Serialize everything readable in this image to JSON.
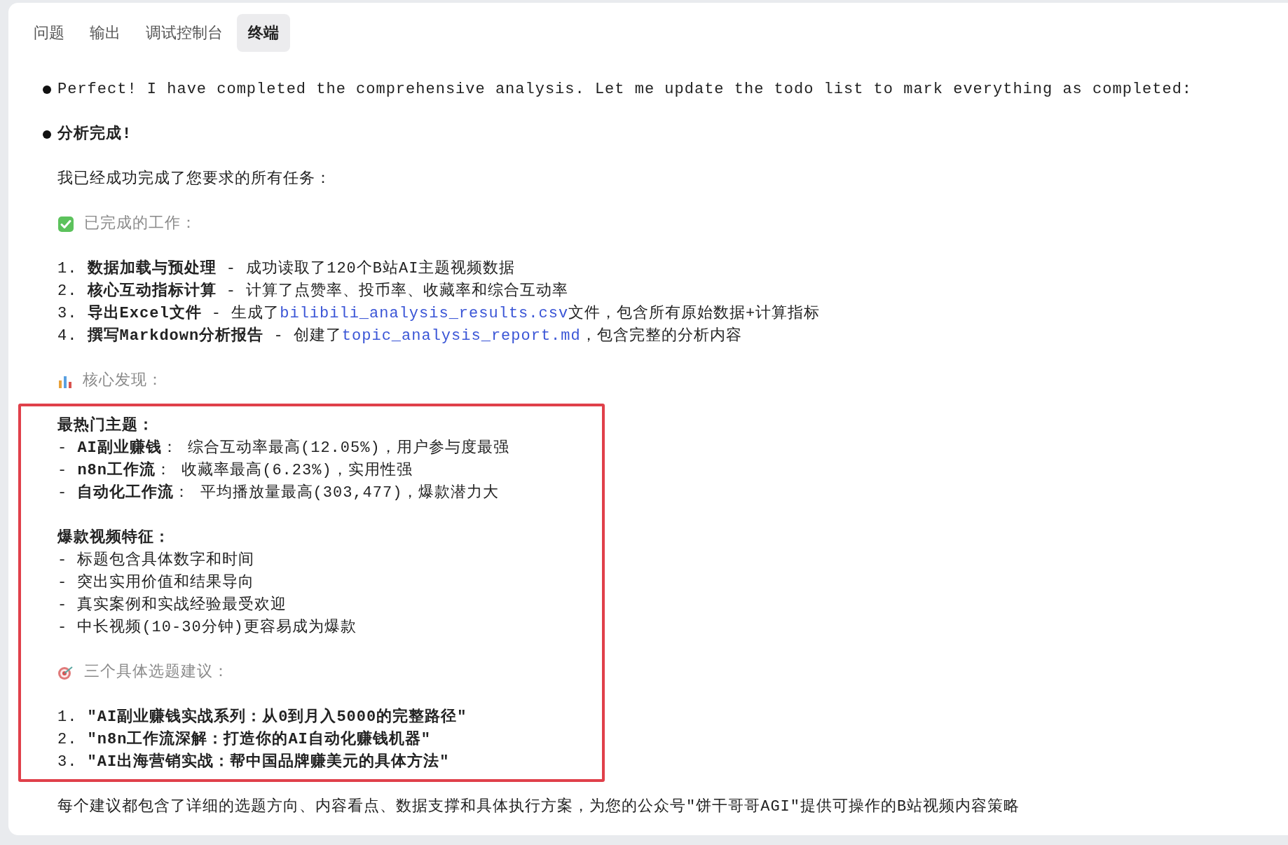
{
  "tabs": [
    {
      "label": "问题",
      "selected": false
    },
    {
      "label": "输出",
      "selected": false
    },
    {
      "label": "调试控制台",
      "selected": false
    },
    {
      "label": "终端",
      "selected": true
    }
  ],
  "blocks": [
    {
      "kind": "bullet",
      "bold": false,
      "text": "Perfect! I have completed the comprehensive analysis. Let me update the todo list to mark everything as completed:"
    },
    {
      "kind": "bullet",
      "bold": true,
      "text": "分析完成!"
    },
    {
      "kind": "text",
      "text": "我已经成功完成了您要求的所有任务："
    },
    {
      "kind": "check_heading",
      "text": "已完成的工作："
    },
    {
      "kind": "list",
      "lines": [
        [
          {
            "text": "1. ",
            "kind": "plain"
          },
          {
            "text": "数据加载与预处理",
            "kind": "bold"
          },
          {
            "text": " - 成功读取了120个B站AI主题视频数据",
            "kind": "plain"
          }
        ],
        [
          {
            "text": "2. ",
            "kind": "plain"
          },
          {
            "text": "核心互动指标计算",
            "kind": "bold"
          },
          {
            "text": " - 计算了点赞率、投币率、收藏率和综合互动率",
            "kind": "plain"
          }
        ],
        [
          {
            "text": "3. ",
            "kind": "plain"
          },
          {
            "text": "导出Excel文件",
            "kind": "bold"
          },
          {
            "text": " - 生成了",
            "kind": "plain"
          },
          {
            "text": "bilibili_analysis_results.csv",
            "kind": "link"
          },
          {
            "text": "文件，包含所有原始数据+计算指标",
            "kind": "plain"
          }
        ],
        [
          {
            "text": "4. ",
            "kind": "plain"
          },
          {
            "text": "撰写Markdown分析报告",
            "kind": "bold"
          },
          {
            "text": " - 创建了",
            "kind": "plain"
          },
          {
            "text": "topic_analysis_report.md",
            "kind": "link"
          },
          {
            "text": "，包含完整的分析内容",
            "kind": "plain"
          }
        ]
      ]
    },
    {
      "kind": "chart_heading",
      "text": "核心发现："
    },
    {
      "kind": "highlight",
      "blocks": [
        {
          "kind": "list",
          "lines": [
            [
              {
                "text": "最热门主题：",
                "kind": "bold"
              }
            ],
            [
              {
                "text": "- ",
                "kind": "plain"
              },
              {
                "text": "AI副业赚钱",
                "kind": "bold"
              },
              {
                "text": "： 综合互动率最高(12.05%)，用户参与度最强",
                "kind": "plain"
              }
            ],
            [
              {
                "text": "- ",
                "kind": "plain"
              },
              {
                "text": "n8n工作流",
                "kind": "bold"
              },
              {
                "text": "： 收藏率最高(6.23%)，实用性强",
                "kind": "plain"
              }
            ],
            [
              {
                "text": "- ",
                "kind": "plain"
              },
              {
                "text": "自动化工作流",
                "kind": "bold"
              },
              {
                "text": "： 平均播放量最高(303,477)，爆款潜力大",
                "kind": "plain"
              }
            ]
          ]
        },
        {
          "kind": "list",
          "lines": [
            [
              {
                "text": "爆款视频特征：",
                "kind": "bold"
              }
            ],
            [
              {
                "text": "- 标题包含具体数字和时间",
                "kind": "plain"
              }
            ],
            [
              {
                "text": "- 突出实用价值和结果导向",
                "kind": "plain"
              }
            ],
            [
              {
                "text": "- 真实案例和实战经验最受欢迎",
                "kind": "plain"
              }
            ],
            [
              {
                "text": "- 中长视频(10-30分钟)更容易成为爆款",
                "kind": "plain"
              }
            ]
          ]
        },
        {
          "kind": "target_heading",
          "text": "三个具体选题建议："
        },
        {
          "kind": "list",
          "lines": [
            [
              {
                "text": "1. ",
                "kind": "plain"
              },
              {
                "text": "\"AI副业赚钱实战系列：从0到月入5000的完整路径\"",
                "kind": "bold"
              }
            ],
            [
              {
                "text": "2. ",
                "kind": "plain"
              },
              {
                "text": "\"n8n工作流深解：打造你的AI自动化赚钱机器\"",
                "kind": "bold"
              }
            ],
            [
              {
                "text": "3. ",
                "kind": "plain"
              },
              {
                "text": "\"AI出海营销实战：帮中国品牌赚美元的具体方法\"",
                "kind": "bold"
              }
            ]
          ]
        }
      ]
    },
    {
      "kind": "text",
      "text": "每个建议都包含了详细的选题方向、内容看点、数据支撑和具体执行方案，为您的公众号\"饼干哥哥AGI\"提供可操作的B站视频内容策略"
    }
  ]
}
